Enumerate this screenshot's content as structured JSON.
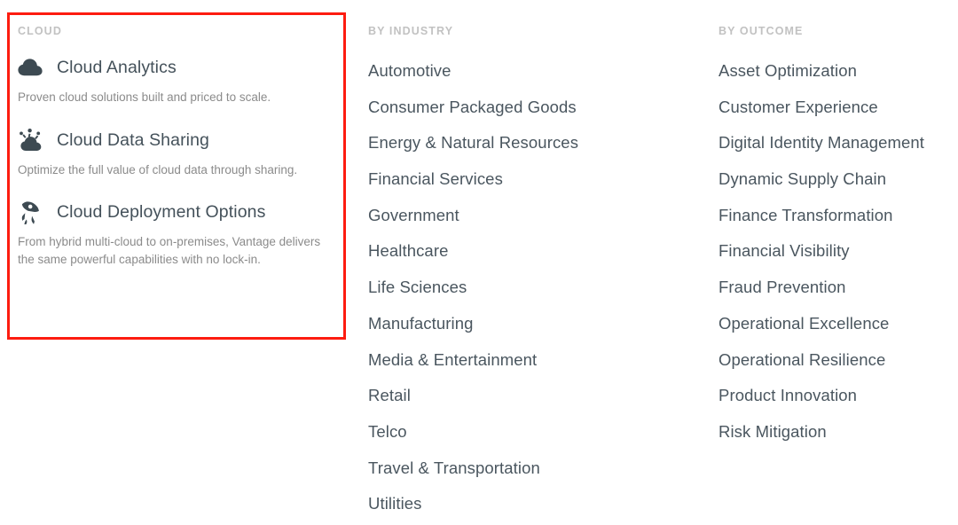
{
  "highlight": {
    "color": "#fd1c10",
    "target": "cloud-column"
  },
  "columns": {
    "cloud": {
      "heading": "CLOUD",
      "items": [
        {
          "icon": "cloud-icon",
          "title": "Cloud Analytics",
          "description": "Proven cloud solutions built and priced to scale."
        },
        {
          "icon": "cloud-data-sharing-icon",
          "title": "Cloud Data Sharing",
          "description": "Optimize the full value of cloud data through sharing."
        },
        {
          "icon": "rocket-icon",
          "title": "Cloud Deployment Options",
          "description": "From hybrid multi-cloud to on-premises, Vantage delivers the same powerful capabilities with no lock-in."
        }
      ]
    },
    "industry": {
      "heading": "BY INDUSTRY",
      "items": [
        "Automotive",
        "Consumer Packaged Goods",
        "Energy & Natural Resources",
        "Financial Services",
        "Government",
        "Healthcare",
        "Life Sciences",
        "Manufacturing",
        "Media & Entertainment",
        "Retail",
        "Telco",
        "Travel & Transportation",
        "Utilities"
      ]
    },
    "outcome": {
      "heading": "BY OUTCOME",
      "items": [
        "Asset Optimization",
        "Customer Experience",
        "Digital Identity Management",
        "Dynamic Supply Chain",
        "Finance Transformation",
        "Financial Visibility",
        "Fraud Prevention",
        "Operational Excellence",
        "Operational Resilience",
        "Product Innovation",
        "Risk Mitigation"
      ]
    }
  },
  "colors": {
    "heading": "#c2c2c2",
    "link": "#4a565f",
    "description": "#8b8b8b",
    "icon": "#3d4a52",
    "highlight": "#fd1c10",
    "background": "#ffffff"
  }
}
